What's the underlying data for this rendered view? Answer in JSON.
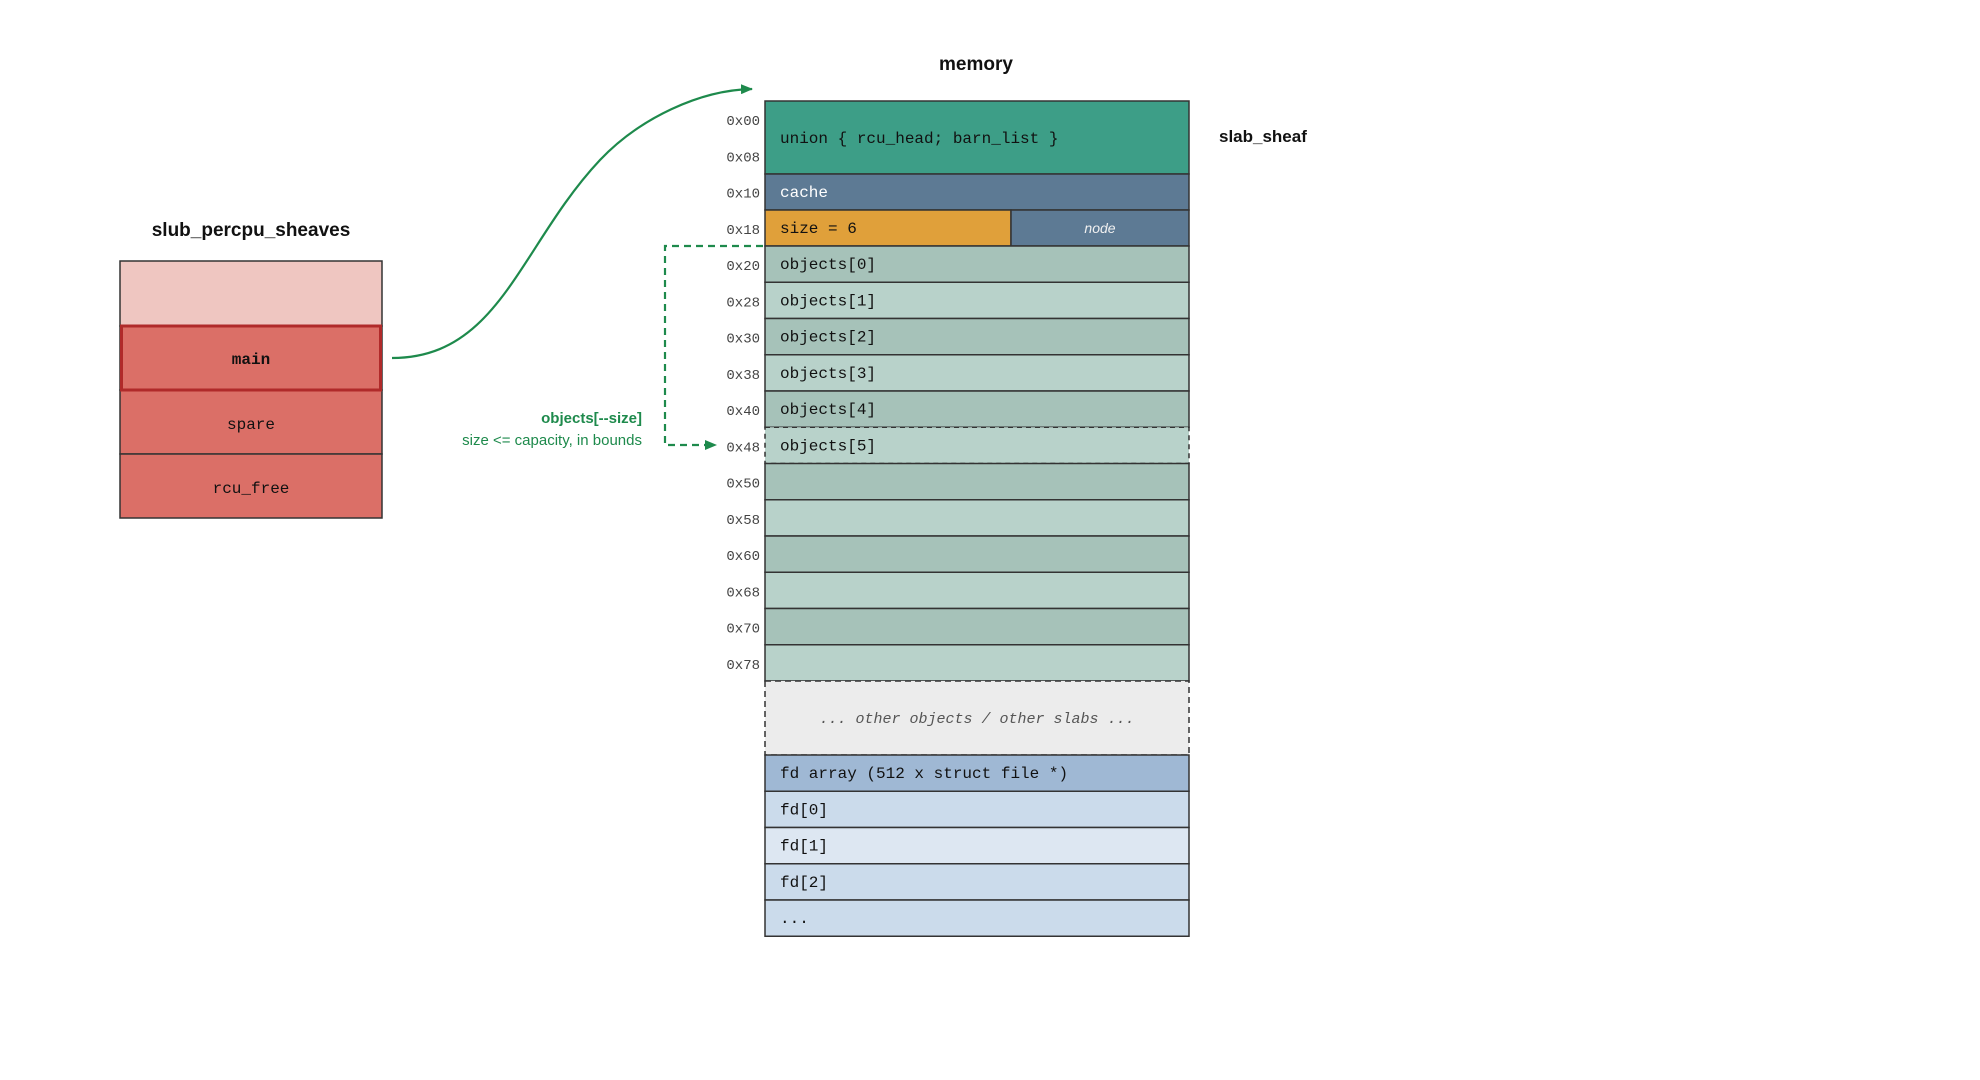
{
  "left": {
    "title": "slub_percpu_sheaves",
    "fields": [
      "",
      "main",
      "spare",
      "rcu_free"
    ]
  },
  "memory": {
    "title": "memory",
    "side_label": "slab_sheaf",
    "addresses": [
      "0x00",
      "0x08",
      "0x10",
      "0x18",
      "0x20",
      "0x28",
      "0x30",
      "0x38",
      "0x40",
      "0x48",
      "0x50",
      "0x58",
      "0x60",
      "0x68",
      "0x70",
      "0x78"
    ],
    "union_label": "union { rcu_head; barn_list }",
    "cache_label": "cache",
    "size_label": "size = 6",
    "node_label": "node",
    "objects": [
      "objects[0]",
      "objects[1]",
      "objects[2]",
      "objects[3]",
      "objects[4]",
      "objects[5]",
      "",
      "",
      "",
      "",
      "",
      ""
    ],
    "other_label": "... other objects / other slabs ...",
    "fd_rows": [
      "fd array (512 x struct file *)",
      "fd[0]",
      "fd[1]",
      "fd[2]",
      "..."
    ]
  },
  "annotation": {
    "line1": "objects[--size]",
    "line2": "size <= capacity, in bounds"
  },
  "colors": {
    "sheaf_empty": "#efc6c1",
    "sheaf_field": "#db6f67",
    "sheaf_highlight_border": "#b02a2a",
    "union": "#3d9e87",
    "cache": "#5d7a94",
    "size": "#e0a03a",
    "objects_dark": "#a6c2b9",
    "objects_light": "#b8d2ca",
    "other": "#ececec",
    "fd_header": "#9fb8d4",
    "fd_dark": "#cbdbeb",
    "fd_light": "#dde7f2",
    "arrow_green": "#1e8a4c"
  }
}
